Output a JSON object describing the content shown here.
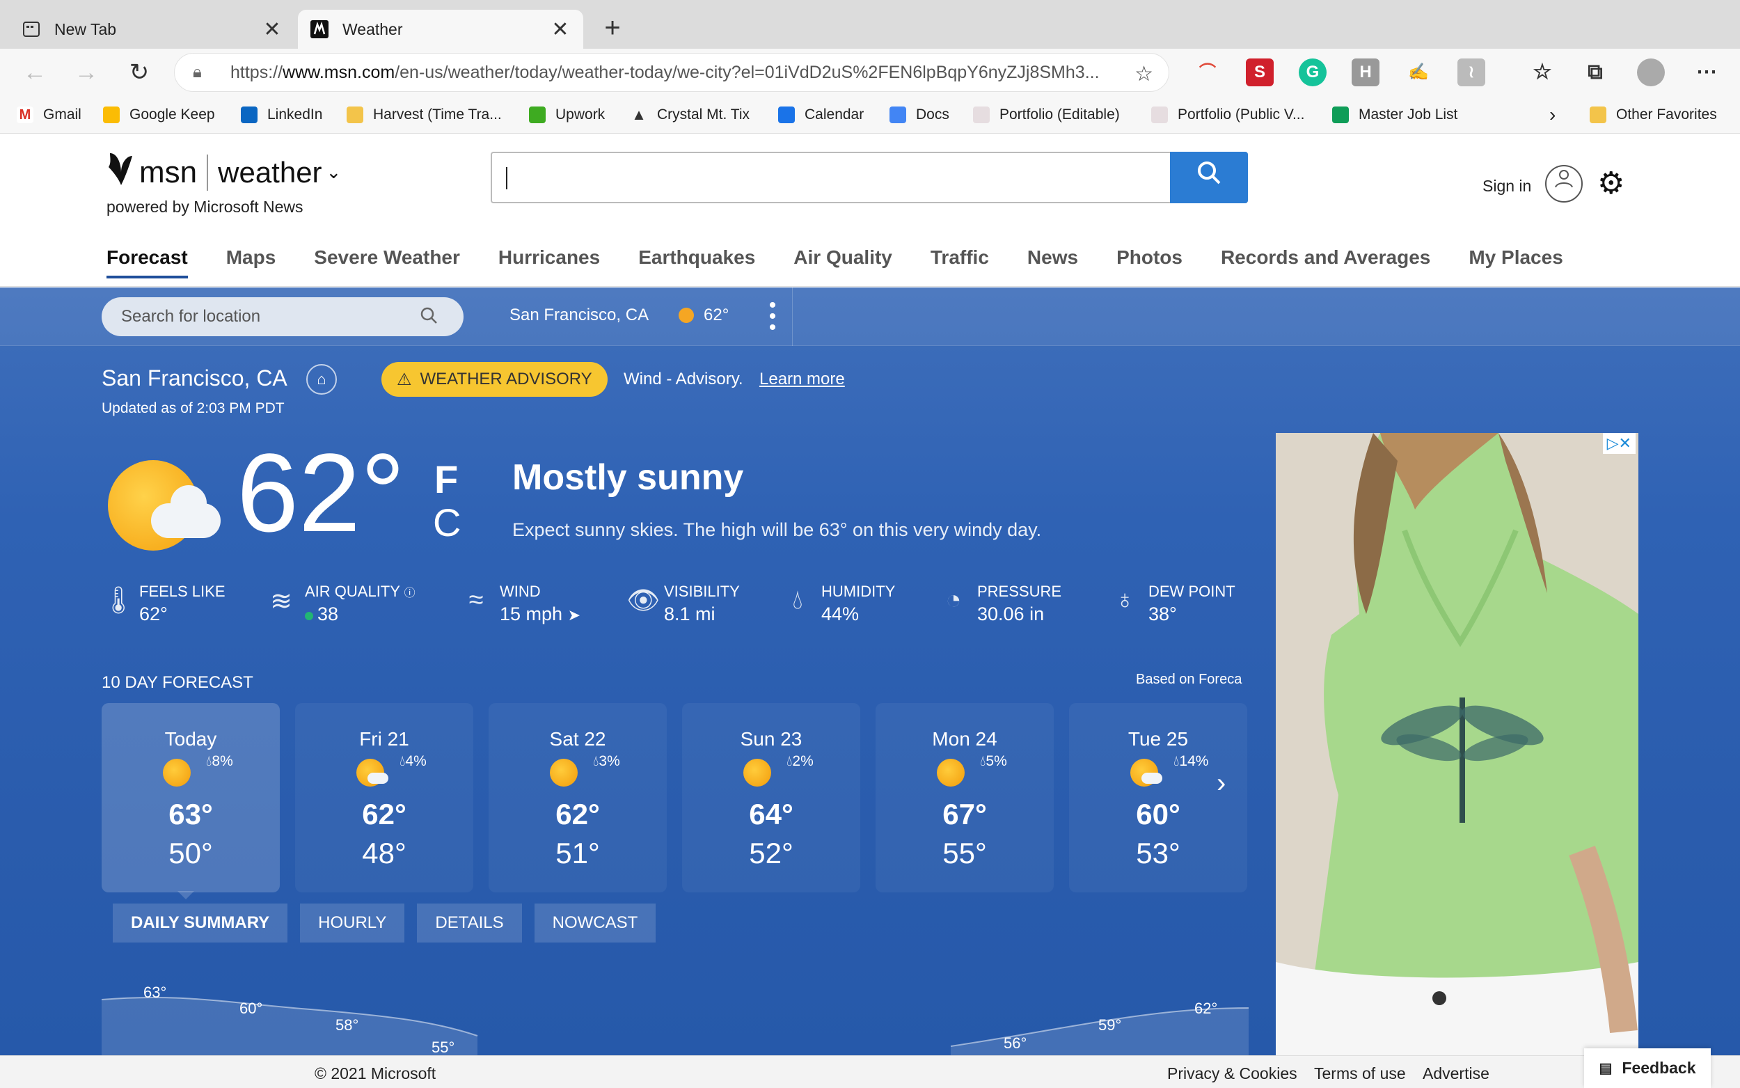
{
  "browser": {
    "tabs": [
      {
        "title": "New Tab",
        "close": "✕"
      },
      {
        "title": "Weather",
        "close": "✕"
      }
    ],
    "new_tab": "+",
    "url_prefix": "https://",
    "url_host": "www.msn.com",
    "url_path": "/en-us/weather/today/weather-today/we-city?el=01iVdD2uS%2FEN6lpBqpY6nyZJj8SMh3...",
    "bookmarks": [
      "Gmail",
      "Google Keep",
      "LinkedIn",
      "Harvest (Time Tra...",
      "Upwork",
      "Crystal Mt. Tix",
      "Calendar",
      "Docs",
      "Portfolio (Editable)",
      "Portfolio (Public V...",
      "Master Job List"
    ],
    "other_favorites": "Other Favorites",
    "more_bookmarks": "›"
  },
  "header": {
    "logo": "msn",
    "section": "weather",
    "powered_by": "powered by Microsoft News",
    "sign_in": "Sign in",
    "nav": [
      "Forecast",
      "Maps",
      "Severe Weather",
      "Hurricanes",
      "Earthquakes",
      "Air Quality",
      "Traffic",
      "News",
      "Photos",
      "Records and Averages",
      "My Places"
    ]
  },
  "location_bar": {
    "placeholder": "Search for location",
    "current_city": "San Francisco, CA",
    "current_temp": "62°"
  },
  "current": {
    "city": "San Francisco, CA",
    "advisory_label": "WEATHER ADVISORY",
    "advisory_text": "Wind - Advisory.",
    "learn_more": "Learn more",
    "updated": "Updated as of 2:03 PM PDT",
    "temp": "62°",
    "unit_f": "F",
    "unit_c": "C",
    "condition": "Mostly sunny",
    "description": "Expect sunny skies. The high will be 63° on this very windy day.",
    "stats": [
      {
        "label": "FEELS LIKE",
        "value": "62°",
        "icon": "thermometer-icon"
      },
      {
        "label": "AIR QUALITY",
        "value": "38",
        "icon": "air-quality-icon"
      },
      {
        "label": "WIND",
        "value": "15 mph",
        "icon": "wind-icon"
      },
      {
        "label": "VISIBILITY",
        "value": "8.1 mi",
        "icon": "eye-icon"
      },
      {
        "label": "HUMIDITY",
        "value": "44%",
        "icon": "droplet-icon"
      },
      {
        "label": "PRESSURE",
        "value": "30.06 in",
        "icon": "gauge-icon"
      },
      {
        "label": "DEW POINT",
        "value": "38°",
        "icon": "dew-point-icon"
      }
    ]
  },
  "forecast": {
    "title": "10 DAY FORECAST",
    "source": "Based on Foreca",
    "days": [
      {
        "name": "Today",
        "precip": "8%",
        "high": "63°",
        "low": "50°",
        "icon": "sunny"
      },
      {
        "name": "Fri 21",
        "precip": "4%",
        "high": "62°",
        "low": "48°",
        "icon": "partly-cloudy"
      },
      {
        "name": "Sat 22",
        "precip": "3%",
        "high": "62°",
        "low": "51°",
        "icon": "sunny"
      },
      {
        "name": "Sun 23",
        "precip": "2%",
        "high": "64°",
        "low": "52°",
        "icon": "sunny"
      },
      {
        "name": "Mon 24",
        "precip": "5%",
        "high": "67°",
        "low": "55°",
        "icon": "sunny"
      },
      {
        "name": "Tue 25",
        "precip": "14%",
        "high": "60°",
        "low": "53°",
        "icon": "partly-cloudy"
      }
    ],
    "view_tabs": [
      "DAILY SUMMARY",
      "HOURLY",
      "DETAILS",
      "NOWCAST"
    ],
    "chart_labels": [
      "63°",
      "60°",
      "58°",
      "55°",
      "56°",
      "59°",
      "62°"
    ]
  },
  "footer": {
    "copyright": "© 2021 Microsoft",
    "privacy": "Privacy & Cookies",
    "terms": "Terms of use",
    "advertise": "Advertise",
    "feedback": "Feedback"
  }
}
